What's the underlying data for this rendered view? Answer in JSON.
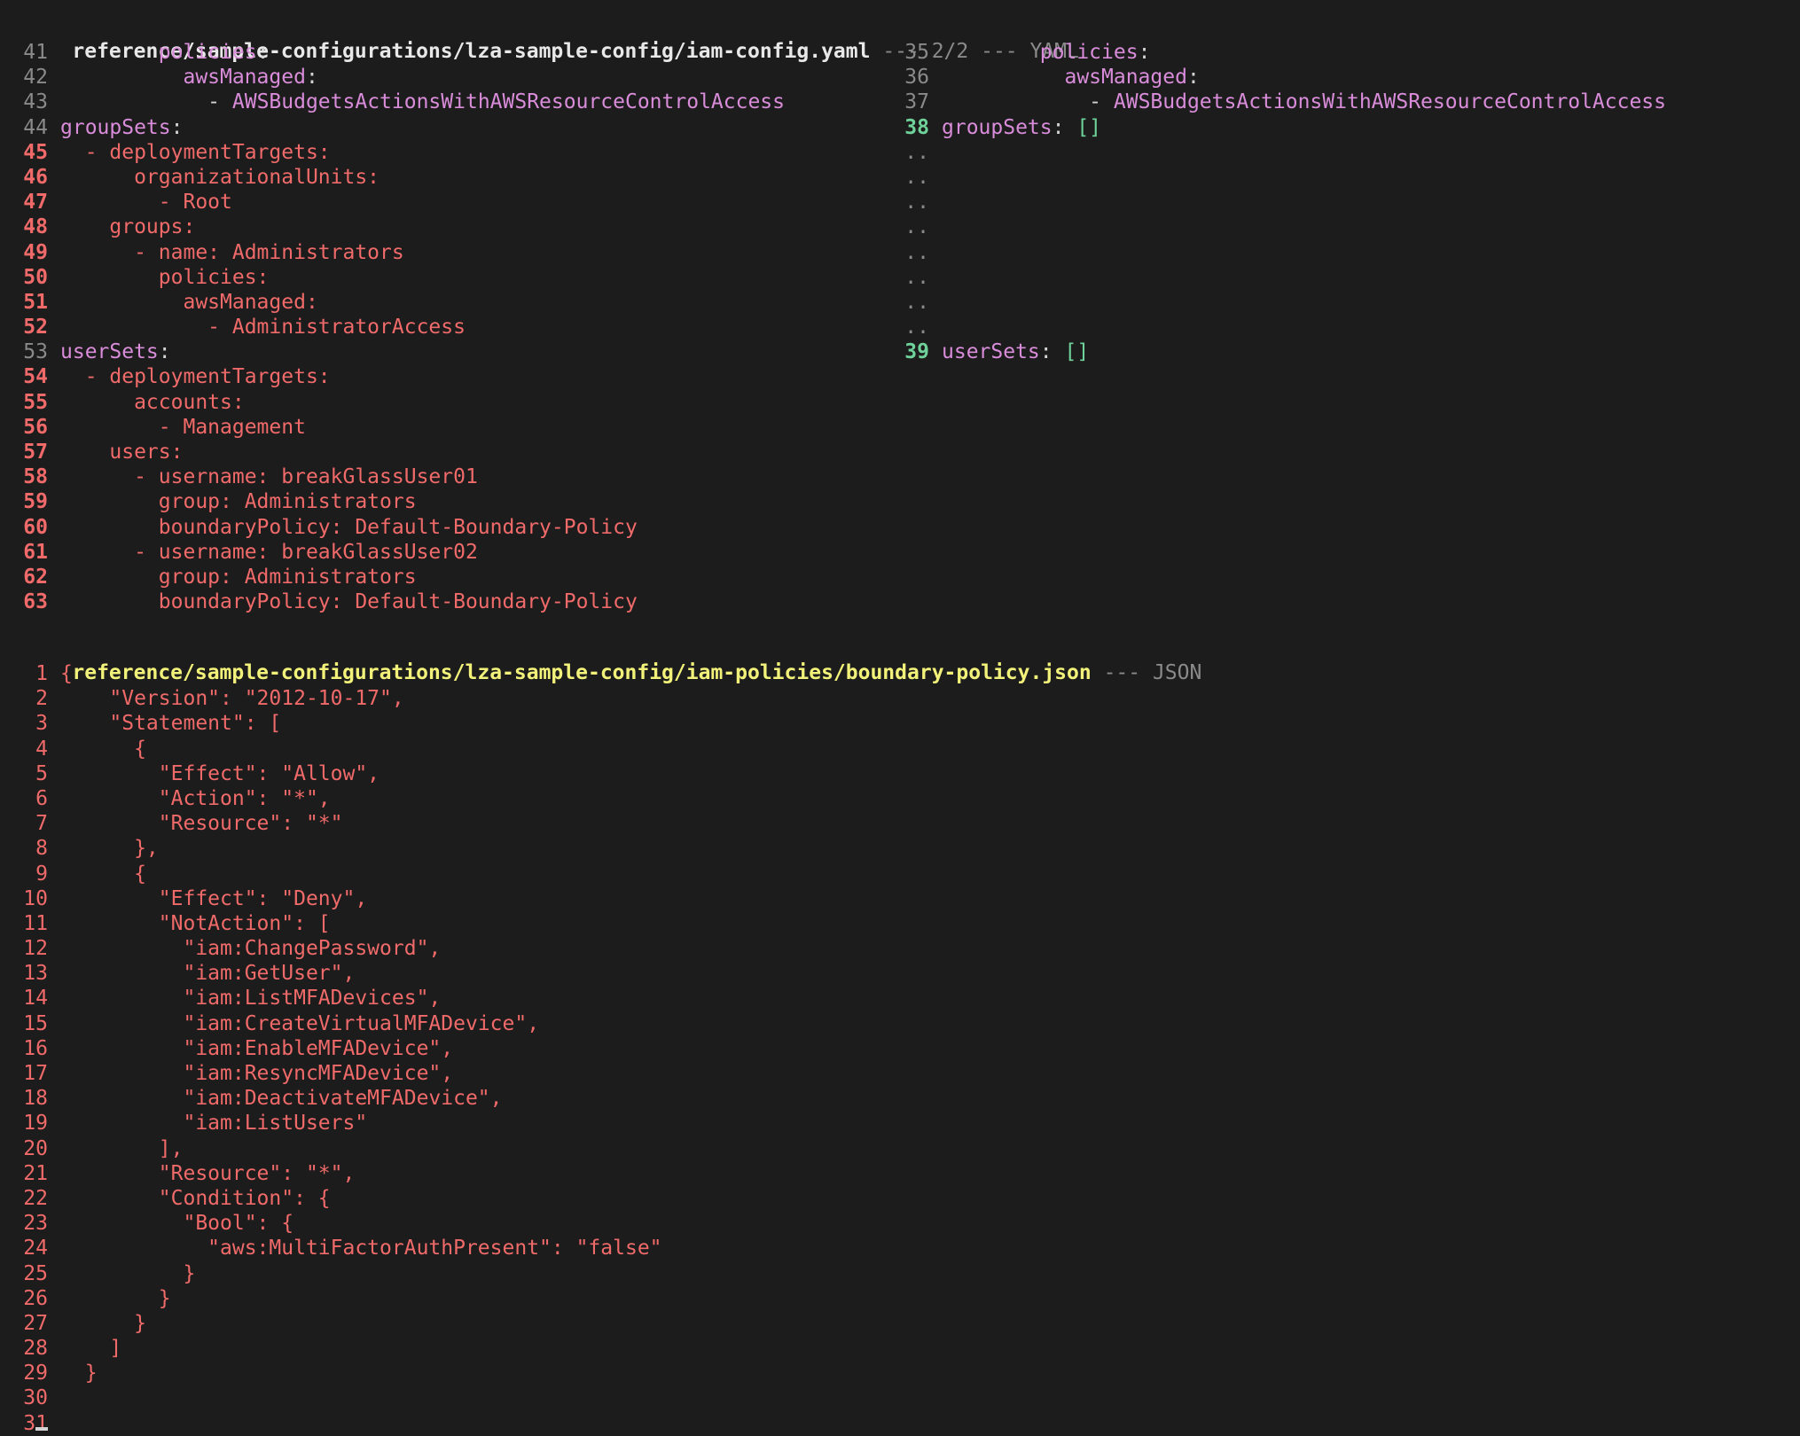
{
  "yaml_file": {
    "path": "reference/sample-configurations/lza-sample-config/iam-config.yaml",
    "meta": " --- 2/2 --- YAML",
    "left_lines": [
      {
        "num": "41",
        "kind": "normal",
        "segments": [
          {
            "t": "        policies",
            "c": "purple"
          },
          {
            "t": ":",
            "c": "white"
          }
        ]
      },
      {
        "num": "42",
        "kind": "normal",
        "segments": [
          {
            "t": "          awsManaged",
            "c": "purple"
          },
          {
            "t": ":",
            "c": "white"
          }
        ]
      },
      {
        "num": "43",
        "kind": "normal",
        "segments": [
          {
            "t": "            - ",
            "c": "white"
          },
          {
            "t": "AWSBudgetsActionsWithAWSResourceControlAccess",
            "c": "purple"
          }
        ]
      },
      {
        "num": "44",
        "kind": "normal",
        "segments": [
          {
            "t": "groupSets",
            "c": "purple"
          },
          {
            "t": ":",
            "c": "white"
          }
        ]
      },
      {
        "num": "45",
        "kind": "del",
        "segments": [
          {
            "t": "  - deploymentTargets:",
            "c": "red"
          }
        ]
      },
      {
        "num": "46",
        "kind": "del",
        "segments": [
          {
            "t": "      organizationalUnits:",
            "c": "red"
          }
        ]
      },
      {
        "num": "47",
        "kind": "del",
        "segments": [
          {
            "t": "        - Root",
            "c": "red"
          }
        ]
      },
      {
        "num": "48",
        "kind": "del",
        "segments": [
          {
            "t": "    groups:",
            "c": "red"
          }
        ]
      },
      {
        "num": "49",
        "kind": "del",
        "segments": [
          {
            "t": "      - name: Administrators",
            "c": "red"
          }
        ]
      },
      {
        "num": "50",
        "kind": "del",
        "segments": [
          {
            "t": "        policies:",
            "c": "red"
          }
        ]
      },
      {
        "num": "51",
        "kind": "del",
        "segments": [
          {
            "t": "          awsManaged:",
            "c": "red"
          }
        ]
      },
      {
        "num": "52",
        "kind": "del",
        "segments": [
          {
            "t": "            - AdministratorAccess",
            "c": "red"
          }
        ]
      },
      {
        "num": "53",
        "kind": "normal",
        "segments": [
          {
            "t": "userSets",
            "c": "purple"
          },
          {
            "t": ":",
            "c": "white"
          }
        ]
      },
      {
        "num": "54",
        "kind": "del",
        "segments": [
          {
            "t": "  - deploymentTargets:",
            "c": "red"
          }
        ]
      },
      {
        "num": "55",
        "kind": "del",
        "segments": [
          {
            "t": "      accounts:",
            "c": "red"
          }
        ]
      },
      {
        "num": "56",
        "kind": "del",
        "segments": [
          {
            "t": "        - Management",
            "c": "red"
          }
        ]
      },
      {
        "num": "57",
        "kind": "del",
        "segments": [
          {
            "t": "    users:",
            "c": "red"
          }
        ]
      },
      {
        "num": "58",
        "kind": "del",
        "segments": [
          {
            "t": "      - username: breakGlassUser01",
            "c": "red"
          }
        ]
      },
      {
        "num": "59",
        "kind": "del",
        "segments": [
          {
            "t": "        group: Administrators",
            "c": "red"
          }
        ]
      },
      {
        "num": "60",
        "kind": "del",
        "segments": [
          {
            "t": "        boundaryPolicy: Default-Boundary-Policy",
            "c": "red"
          }
        ]
      },
      {
        "num": "61",
        "kind": "del",
        "segments": [
          {
            "t": "      - username: breakGlassUser02",
            "c": "red"
          }
        ]
      },
      {
        "num": "62",
        "kind": "del",
        "segments": [
          {
            "t": "        group: Administrators",
            "c": "red"
          }
        ]
      },
      {
        "num": "63",
        "kind": "del",
        "segments": [
          {
            "t": "        boundaryPolicy: Default-Boundary-Policy",
            "c": "red"
          }
        ]
      }
    ],
    "right_lines": [
      {
        "num": "35",
        "kind": "normal",
        "segments": [
          {
            "t": "        policies",
            "c": "purple"
          },
          {
            "t": ":",
            "c": "white"
          }
        ]
      },
      {
        "num": "36",
        "kind": "normal",
        "segments": [
          {
            "t": "          awsManaged",
            "c": "purple"
          },
          {
            "t": ":",
            "c": "white"
          }
        ]
      },
      {
        "num": "37",
        "kind": "normal",
        "segments": [
          {
            "t": "            - ",
            "c": "white"
          },
          {
            "t": "AWSBudgetsActionsWithAWSResourceControlAccess",
            "c": "purple"
          }
        ]
      },
      {
        "num": "38",
        "kind": "add",
        "segments": [
          {
            "t": "groupSets",
            "c": "purple"
          },
          {
            "t": ": ",
            "c": "white"
          },
          {
            "t": "[]",
            "c": "green"
          }
        ]
      },
      {
        "num": "..",
        "kind": "dots",
        "segments": []
      },
      {
        "num": "..",
        "kind": "dots",
        "segments": []
      },
      {
        "num": "..",
        "kind": "dots",
        "segments": []
      },
      {
        "num": "..",
        "kind": "dots",
        "segments": []
      },
      {
        "num": "..",
        "kind": "dots",
        "segments": []
      },
      {
        "num": "..",
        "kind": "dots",
        "segments": []
      },
      {
        "num": "..",
        "kind": "dots",
        "segments": []
      },
      {
        "num": "..",
        "kind": "dots",
        "segments": []
      },
      {
        "num": "39",
        "kind": "add",
        "segments": [
          {
            "t": "userSets",
            "c": "purple"
          },
          {
            "t": ": ",
            "c": "white"
          },
          {
            "t": "[]",
            "c": "green"
          }
        ]
      }
    ]
  },
  "json_file": {
    "path": "reference/sample-configurations/lza-sample-config/iam-policies/boundary-policy.json",
    "meta": " --- JSON",
    "lines": [
      {
        "num": "1",
        "text": "{"
      },
      {
        "num": "2",
        "text": "    \"Version\": \"2012-10-17\","
      },
      {
        "num": "3",
        "text": "    \"Statement\": ["
      },
      {
        "num": "4",
        "text": "      {"
      },
      {
        "num": "5",
        "text": "        \"Effect\": \"Allow\","
      },
      {
        "num": "6",
        "text": "        \"Action\": \"*\","
      },
      {
        "num": "7",
        "text": "        \"Resource\": \"*\""
      },
      {
        "num": "8",
        "text": "      },"
      },
      {
        "num": "9",
        "text": "      {"
      },
      {
        "num": "10",
        "text": "        \"Effect\": \"Deny\","
      },
      {
        "num": "11",
        "text": "        \"NotAction\": ["
      },
      {
        "num": "12",
        "text": "          \"iam:ChangePassword\","
      },
      {
        "num": "13",
        "text": "          \"iam:GetUser\","
      },
      {
        "num": "14",
        "text": "          \"iam:ListMFADevices\","
      },
      {
        "num": "15",
        "text": "          \"iam:CreateVirtualMFADevice\","
      },
      {
        "num": "16",
        "text": "          \"iam:EnableMFADevice\","
      },
      {
        "num": "17",
        "text": "          \"iam:ResyncMFADevice\","
      },
      {
        "num": "18",
        "text": "          \"iam:DeactivateMFADevice\","
      },
      {
        "num": "19",
        "text": "          \"iam:ListUsers\""
      },
      {
        "num": "20",
        "text": "        ],"
      },
      {
        "num": "21",
        "text": "        \"Resource\": \"*\","
      },
      {
        "num": "22",
        "text": "        \"Condition\": {"
      },
      {
        "num": "23",
        "text": "          \"Bool\": {"
      },
      {
        "num": "24",
        "text": "            \"aws:MultiFactorAuthPresent\": \"false\""
      },
      {
        "num": "25",
        "text": "          }"
      },
      {
        "num": "26",
        "text": "        }"
      },
      {
        "num": "27",
        "text": "      }"
      },
      {
        "num": "28",
        "text": "    ]"
      },
      {
        "num": "29",
        "text": "  }"
      },
      {
        "num": "30",
        "text": ""
      },
      {
        "num": "31",
        "text": ""
      }
    ]
  },
  "colors": {
    "background": "#1c1c1c",
    "deleted": "#f06a6a",
    "added": "#6fd29a",
    "key": "#d98cd9",
    "json_header": "#f2f27a",
    "line_number": "#8a8a8a"
  }
}
